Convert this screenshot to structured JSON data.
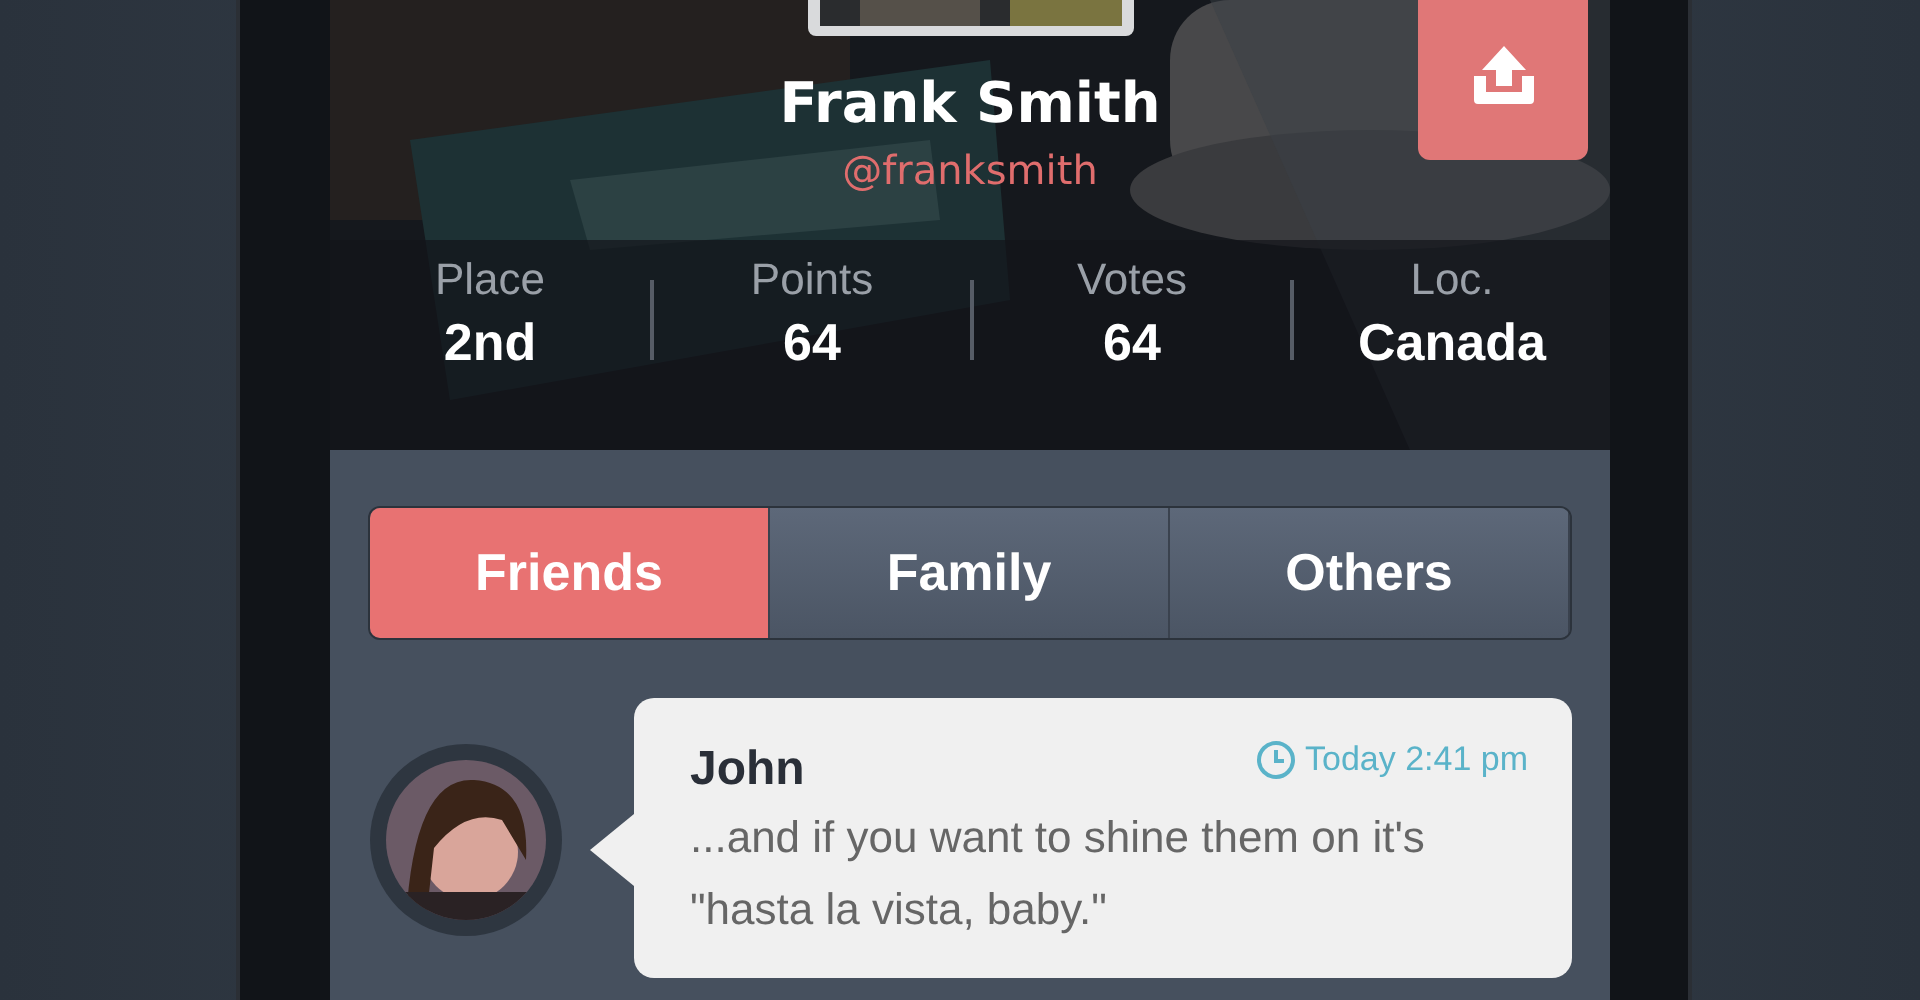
{
  "profile": {
    "name": "Frank Smith",
    "handle": "@franksmith"
  },
  "stats": [
    {
      "label": "Place",
      "value": "2nd"
    },
    {
      "label": "Points",
      "value": "64"
    },
    {
      "label": "Votes",
      "value": "64"
    },
    {
      "label": "Loc.",
      "value": "Canada"
    }
  ],
  "tabs": [
    {
      "label": "Friends",
      "selected": true
    },
    {
      "label": "Family",
      "selected": false
    },
    {
      "label": "Others",
      "selected": false
    }
  ],
  "messages": [
    {
      "name": "John",
      "time": "Today 2:41 pm",
      "text": "...and if you want to shine them on it's \"hasta la vista, baby.\""
    }
  ]
}
